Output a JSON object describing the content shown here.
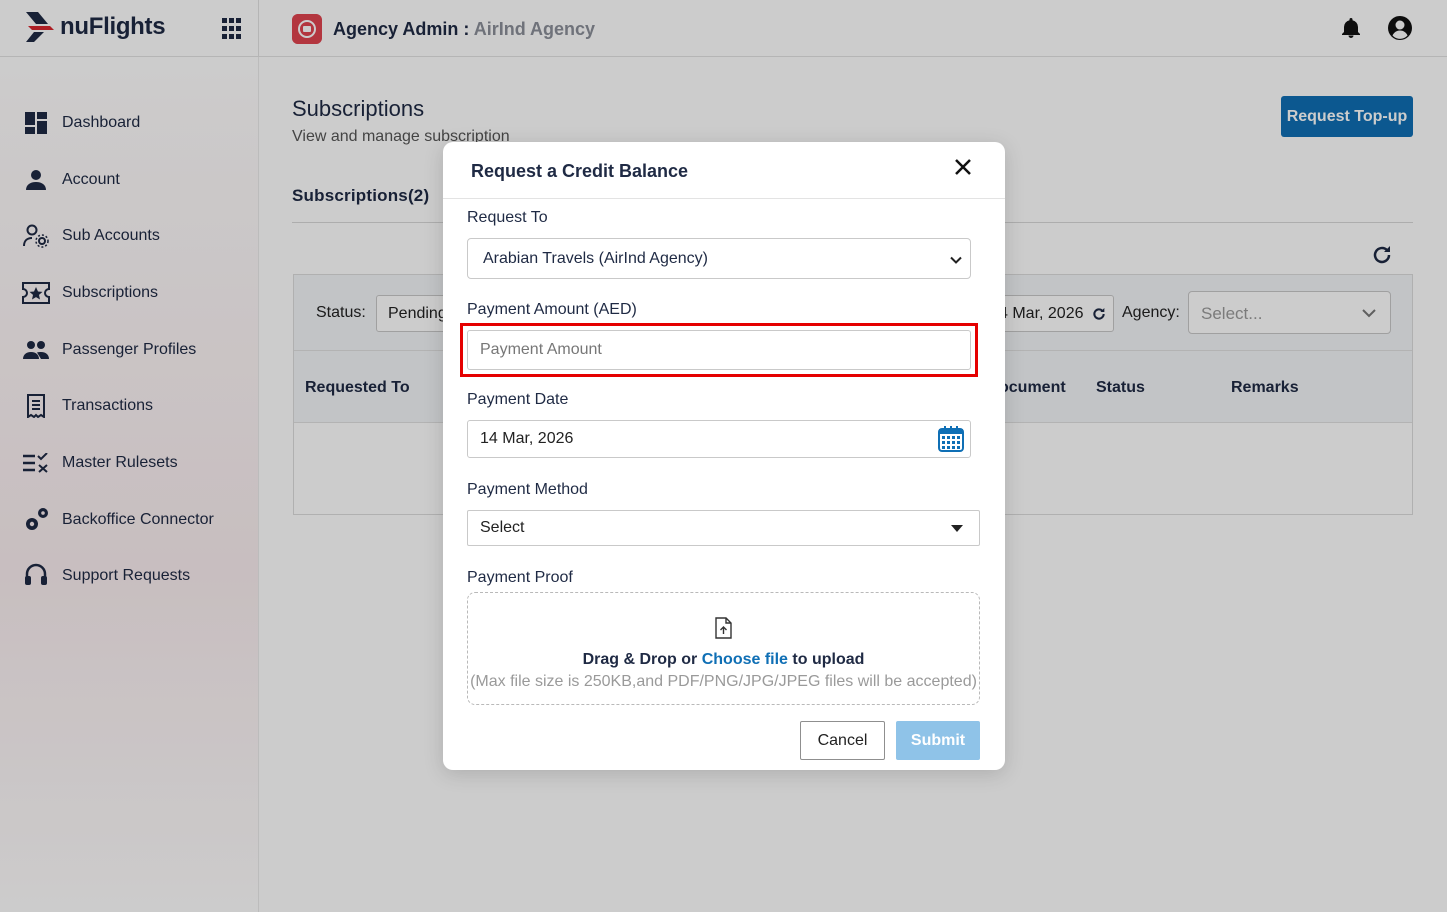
{
  "brand": {
    "name": "nuFlights",
    "accent": "#0f6fb5",
    "logo_colors": [
      "#1f2a44",
      "#d9262e"
    ]
  },
  "header": {
    "title": "Agency Admin :",
    "agency_name": "AirInd Agency",
    "icons": [
      "apps-grid-icon",
      "agency-icon",
      "bell-icon",
      "user-circle-icon"
    ]
  },
  "sidebar": {
    "items": [
      {
        "label": "Dashboard",
        "icon": "dashboard-icon"
      },
      {
        "label": "Account",
        "icon": "person-icon"
      },
      {
        "label": "Sub Accounts",
        "icon": "sub-accounts-icon"
      },
      {
        "label": "Subscriptions",
        "icon": "ticket-star-icon"
      },
      {
        "label": "Passenger Profiles",
        "icon": "people-icon"
      },
      {
        "label": "Transactions",
        "icon": "receipt-icon"
      },
      {
        "label": "Master Rulesets",
        "icon": "rules-list-icon"
      },
      {
        "label": "Backoffice Connector",
        "icon": "gears-icon"
      },
      {
        "label": "Support Requests",
        "icon": "headset-icon"
      }
    ]
  },
  "main": {
    "title": "Subscriptions",
    "subtitle": "View and manage subscription",
    "topup_button": "Request Top-up",
    "tab_label": "Subscriptions(2)",
    "filters": {
      "status_label": "Status:",
      "status_value": "Pending",
      "date_range_visible": "4 Mar, 2026",
      "agency_label": "Agency:",
      "agency_placeholder": "Select..."
    },
    "table_headers": [
      "Requested To",
      "ocument",
      "Status",
      "Remarks"
    ]
  },
  "modal": {
    "title": "Request a Credit Balance",
    "request_to_label": "Request To",
    "request_to_value": "Arabian Travels (AirInd Agency)",
    "amount_label": "Payment Amount (AED)",
    "amount_placeholder": "Payment Amount",
    "amount_value": "",
    "date_label": "Payment Date",
    "date_value": "14 Mar, 2026",
    "method_label": "Payment Method",
    "method_value": "Select",
    "proof_label": "Payment Proof",
    "dropzone_text_1": "Drag & Drop or",
    "dropzone_link": "Choose file",
    "dropzone_text_2": "to upload",
    "dropzone_note": "(Max file size is 250KB,and PDF/PNG/JPG/JPEG files will be accepted)",
    "cancel_label": "Cancel",
    "submit_label": "Submit",
    "highlight_color": "#e50000"
  }
}
